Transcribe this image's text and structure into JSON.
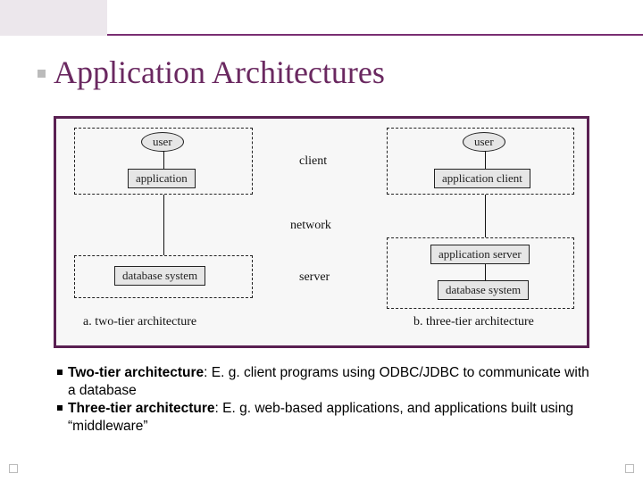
{
  "title": "Application Architectures",
  "diagram": {
    "left": {
      "user": "user",
      "app": "application",
      "db": "database system",
      "caption": "a.  two-tier architecture"
    },
    "mid": {
      "client": "client",
      "network": "network",
      "server": "server"
    },
    "right": {
      "user": "user",
      "appclient": "application client",
      "appserver": "application server",
      "db": "database system",
      "caption": "b.  three-tier architecture"
    }
  },
  "bullets": {
    "b1_term": "Two-tier architecture",
    "b1_rest": ":  E. g. client programs using ODBC/JDBC to communicate with a database",
    "b2_term": "Three-tier architecture",
    "b2_rest": ": E. g. web-based applications, and applications built using “middleware”"
  }
}
